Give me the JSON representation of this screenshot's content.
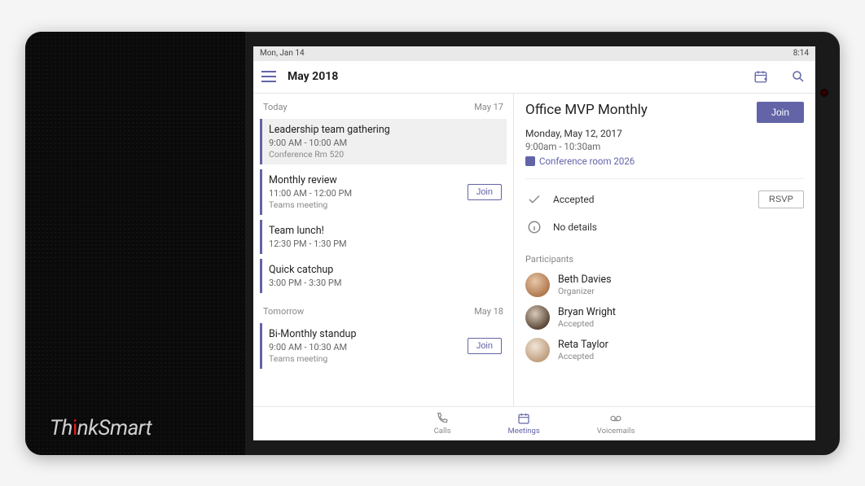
{
  "device": {
    "brand_think": "Th",
    "brand_i": "i",
    "brand_nksmart": "nkSmart"
  },
  "status": {
    "date": "Mon, Jan 14",
    "time": "8:14"
  },
  "header": {
    "title": "May 2018",
    "icons": {
      "calendar_add": "calendar-add-icon",
      "search": "search-icon"
    }
  },
  "sections": [
    {
      "label": "Today",
      "date": "May 17",
      "events": [
        {
          "title": "Leadership team gathering",
          "time": "9:00 AM - 10:00 AM",
          "loc": "Conference Rm 520",
          "selected": true,
          "showJoin": false
        },
        {
          "title": "Monthly review",
          "time": "11:00 AM - 12:00 PM",
          "loc": "Teams meeting",
          "selected": false,
          "showJoin": true
        },
        {
          "title": "Team lunch!",
          "time": "12:30 PM - 1:30 PM",
          "loc": "",
          "selected": false,
          "showJoin": false
        },
        {
          "title": "Quick catchup",
          "time": "3:00 PM - 3:30 PM",
          "loc": "",
          "selected": false,
          "showJoin": false
        }
      ]
    },
    {
      "label": "Tomorrow",
      "date": "May 18",
      "events": [
        {
          "title": "Bi-Monthly standup",
          "time": "9:00 AM - 10:30 AM",
          "loc": "Teams meeting",
          "selected": false,
          "showJoin": true
        }
      ]
    }
  ],
  "detail": {
    "title": "Office MVP Monthly",
    "join_label": "Join",
    "date": "Monday, May 12, 2017",
    "time": "9:00am - 10:30am",
    "room": "Conference room 2026",
    "status": "Accepted",
    "rsvp_label": "RSVP",
    "no_details": "No details",
    "participants_label": "Participants",
    "participants": [
      {
        "name": "Beth Davies",
        "role": "Organizer",
        "avatarClass": "av-a"
      },
      {
        "name": "Bryan Wright",
        "role": "Accepted",
        "avatarClass": "av-b"
      },
      {
        "name": "Reta Taylor",
        "role": "Accepted",
        "avatarClass": "av-c"
      }
    ]
  },
  "nav": {
    "calls": "Calls",
    "meetings": "Meetings",
    "voicemails": "Voicemails"
  },
  "labels": {
    "join": "Join"
  }
}
